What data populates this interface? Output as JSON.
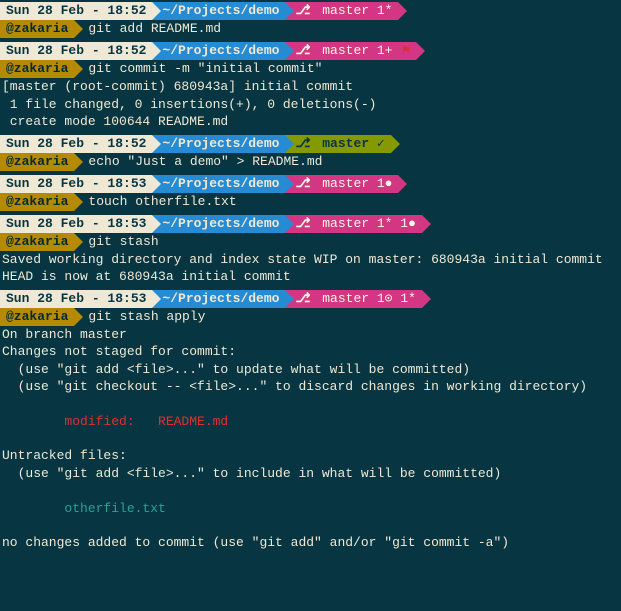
{
  "user": "@zakaria",
  "path": "~/Projects/demo",
  "blocks": [
    {
      "time": "Sun 28 Feb - 18:52",
      "branch_style": "pink",
      "branch": " master 1*",
      "cmd": "git add README.md",
      "output": []
    },
    {
      "time": "Sun 28 Feb - 18:52",
      "branch_style": "pink",
      "branch": " master 1+ ",
      "flag": "⚑",
      "cmd": "git commit -m \"initial commit\"",
      "output": [
        {
          "t": "[master (root-commit) 680943a] initial commit"
        },
        {
          "t": " 1 file changed, 0 insertions(+), 0 deletions(-)"
        },
        {
          "t": " create mode 100644 README.md"
        }
      ]
    },
    {
      "time": "Sun 28 Feb - 18:52",
      "branch_style": "green",
      "branch": " master ✓",
      "cmd": "echo \"Just a demo\" > README.md",
      "output": []
    },
    {
      "time": "Sun 28 Feb - 18:53",
      "branch_style": "pink",
      "branch": " master 1●",
      "cmd": "touch otherfile.txt",
      "output": []
    },
    {
      "time": "Sun 28 Feb - 18:53",
      "branch_style": "pink",
      "branch": " master 1* 1●",
      "cmd": "git stash",
      "output": [
        {
          "t": "Saved working directory and index state WIP on master: 680943a initial commit"
        },
        {
          "t": "HEAD is now at 680943a initial commit"
        }
      ]
    },
    {
      "time": "Sun 28 Feb - 18:53",
      "branch_style": "pink",
      "branch": " master 1⊙ 1*",
      "cmd": "git stash apply",
      "output": [
        {
          "t": "On branch master"
        },
        {
          "t": "Changes not staged for commit:"
        },
        {
          "t": "  (use \"git add <file>...\" to update what will be committed)"
        },
        {
          "t": "  (use \"git checkout -- <file>...\" to discard changes in working directory)"
        },
        {
          "t": ""
        },
        {
          "t": "        modified:   README.md",
          "cls": "red"
        },
        {
          "t": ""
        },
        {
          "t": "Untracked files:"
        },
        {
          "t": "  (use \"git add <file>...\" to include in what will be committed)"
        },
        {
          "t": ""
        },
        {
          "t": "        otherfile.txt",
          "cls": "cyan"
        },
        {
          "t": ""
        },
        {
          "t": "no changes added to commit (use \"git add\" and/or \"git commit -a\")"
        }
      ]
    }
  ]
}
